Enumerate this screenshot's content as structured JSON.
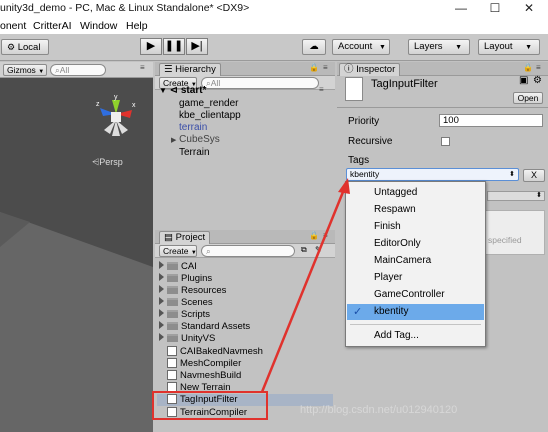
{
  "window": {
    "title": "unity3d_demo - PC, Mac & Linux Standalone* <DX9>",
    "controls": [
      "—",
      "☐",
      "✕"
    ]
  },
  "menubar": [
    "onent",
    "CritterAI",
    "Window",
    "Help"
  ],
  "toolbar": {
    "local_label": "Local",
    "account_label": "Account",
    "layers_label": "Layers",
    "layout_label": "Layout"
  },
  "scene": {
    "gizmos_label": "Gizmos",
    "search_placeholder": "All",
    "persp_label": "Persp",
    "axis_labels": [
      "y",
      "z",
      "x"
    ]
  },
  "hierarchy": {
    "tab_label": "Hierarchy",
    "create_label": "Create",
    "search_placeholder": "All",
    "root": "start*",
    "items": [
      {
        "label": "game_render",
        "color": "#000000"
      },
      {
        "label": "kbe_clientapp",
        "color": "#000000"
      },
      {
        "label": "terrain",
        "color": "#3a4ea8"
      },
      {
        "label": "CubeSys",
        "color": "#444444"
      },
      {
        "label": "Terrain",
        "color": "#000000"
      }
    ]
  },
  "project": {
    "tab_label": "Project",
    "create_label": "Create",
    "items": [
      {
        "label": "CAI",
        "kind": "folder"
      },
      {
        "label": "Plugins",
        "kind": "folder"
      },
      {
        "label": "Resources",
        "kind": "folder"
      },
      {
        "label": "Scenes",
        "kind": "folder"
      },
      {
        "label": "Scripts",
        "kind": "folder"
      },
      {
        "label": "Standard Assets",
        "kind": "folder"
      },
      {
        "label": "UnityVS",
        "kind": "folder"
      },
      {
        "label": "CAIBakedNavmesh",
        "kind": "asset"
      },
      {
        "label": "MeshCompiler",
        "kind": "asset"
      },
      {
        "label": "NavmeshBuild",
        "kind": "asset"
      },
      {
        "label": "New Terrain",
        "kind": "asset"
      },
      {
        "label": "TagInputFilter",
        "kind": "asset"
      },
      {
        "label": "TerrainCompiler",
        "kind": "asset"
      }
    ]
  },
  "inspector": {
    "tab_label": "Inspector",
    "object_name": "TagInputFilter",
    "open_label": "Open",
    "priority_label": "Priority",
    "priority_value": "100",
    "recursive_label": "Recursive",
    "tags_label": "Tags",
    "tag_value": "kbentity",
    "remove_label": "X",
    "partial_text": "specified"
  },
  "tag_dropdown": {
    "options": [
      "Untagged",
      "Respawn",
      "Finish",
      "EditorOnly",
      "MainCamera",
      "Player",
      "GameController",
      "kbentity"
    ],
    "selected_index": 7,
    "add_label": "Add Tag..."
  },
  "watermark": "http://blog.csdn.net/u012940120",
  "colors": {
    "highlight_red": "#e0322d",
    "selection_blue": "#6caaea",
    "scene_background": "#4c4c4c"
  }
}
